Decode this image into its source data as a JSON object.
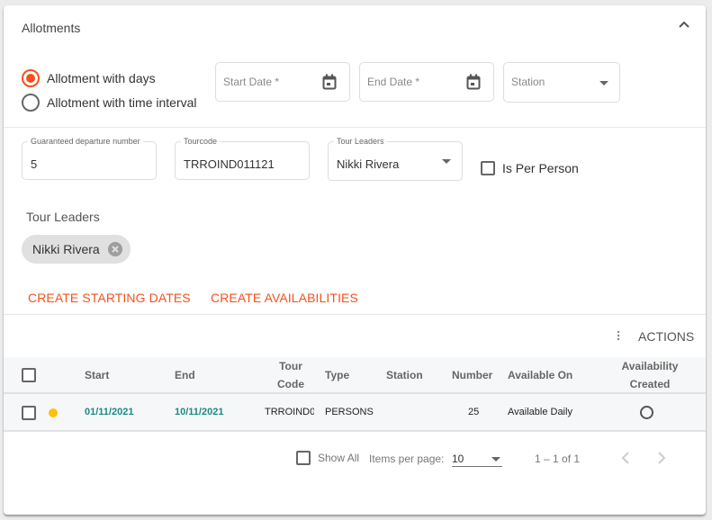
{
  "panel": {
    "title": "Allotments",
    "collapse_icon": "chevron-up-icon"
  },
  "mode": {
    "options": [
      {
        "label": "Allotment with days",
        "selected": true
      },
      {
        "label": "Allotment with time interval",
        "selected": false
      }
    ]
  },
  "filters": {
    "start_date": {
      "placeholder": "Start Date *",
      "icon": "calendar-icon"
    },
    "end_date": {
      "placeholder": "End Date *",
      "icon": "calendar-icon"
    },
    "station": {
      "placeholder": "Station",
      "icon": "dropdown-arrow-icon"
    }
  },
  "details": {
    "guaranteed_departure": {
      "label": "Guaranteed departure number",
      "value": "5"
    },
    "tourcode": {
      "label": "Tourcode",
      "value": "TRROIND011121"
    },
    "tour_leaders_select": {
      "label": "Tour Leaders",
      "value": "Nikki Rivera"
    },
    "is_per_person": {
      "label": "Is Per Person",
      "checked": false
    }
  },
  "tour_leaders": {
    "heading": "Tour Leaders",
    "chips": [
      "Nikki Rivera"
    ]
  },
  "actions_bar": {
    "create_starting_dates": "CREATE STARTING DATES",
    "create_availabilities": "CREATE AVAILABILITIES",
    "accent_color": "#f4511e"
  },
  "table": {
    "toolbar_actions": "ACTIONS",
    "columns": {
      "start": "Start",
      "end": "End",
      "tour_code_1": "Tour",
      "tour_code_2": "Code",
      "type": "Type",
      "station": "Station",
      "number": "Number",
      "available_on": "Available On",
      "availability_created_1": "Availability",
      "availability_created_2": "Created"
    },
    "rows": [
      {
        "status_color": "#ffc107",
        "start": "01/11/2021",
        "end": "10/11/2021",
        "tour_code": "TRROIND0",
        "type": "PERSONS",
        "station": "",
        "number": "25",
        "available_on": "Available Daily",
        "availability_created": false
      }
    ]
  },
  "pagination": {
    "show_all": "Show All",
    "items_per_page_label": "Items per page:",
    "items_per_page": "10",
    "range": "1 – 1 of 1"
  }
}
